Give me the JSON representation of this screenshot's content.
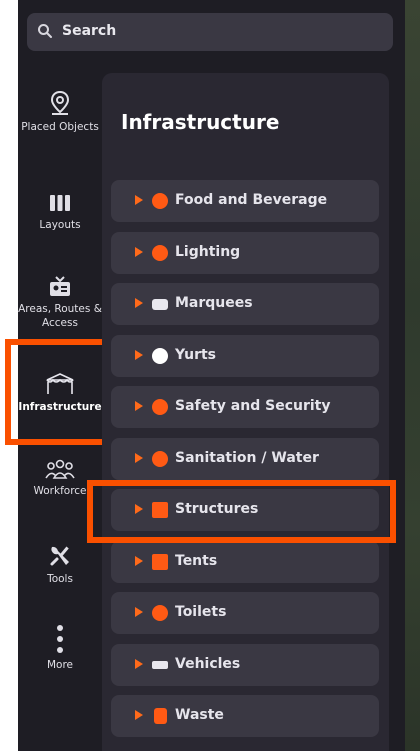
{
  "search": {
    "label": "Search"
  },
  "sidebar": {
    "items": [
      {
        "label": "Placed Objects",
        "icon": "map-pin-icon"
      },
      {
        "label": "Layouts",
        "icon": "columns-icon"
      },
      {
        "label": "Areas, Routes & Access",
        "icon": "id-badge-icon"
      },
      {
        "label": "Infrastructure",
        "icon": "canopy-icon",
        "active": true
      },
      {
        "label": "Workforce",
        "icon": "people-icon"
      },
      {
        "label": "Tools",
        "icon": "wrench-screwdriver-icon"
      },
      {
        "label": "More",
        "icon": "dots-vertical-icon"
      }
    ]
  },
  "panel": {
    "title": "Infrastructure",
    "categories": [
      {
        "label": "Food and Beverage",
        "icon": "cutlery-icon"
      },
      {
        "label": "Lighting",
        "icon": "lamp-icon"
      },
      {
        "label": "Marquees",
        "icon": "marquee-icon"
      },
      {
        "label": "Yurts",
        "icon": "yurt-icon"
      },
      {
        "label": "Safety and Security",
        "icon": "first-aid-icon"
      },
      {
        "label": "Sanitation / Water",
        "icon": "tap-icon"
      },
      {
        "label": "Structures",
        "icon": "structure-icon"
      },
      {
        "label": "Tents",
        "icon": "tent-icon"
      },
      {
        "label": "Toilets",
        "icon": "toilet-icon"
      },
      {
        "label": "Vehicles",
        "icon": "vehicle-icon"
      },
      {
        "label": "Waste",
        "icon": "bin-icon"
      }
    ]
  },
  "colors": {
    "accent": "#fa5000",
    "panel": "#2a2832",
    "item": "#3a3843",
    "sidebar": "#1e1d24"
  }
}
